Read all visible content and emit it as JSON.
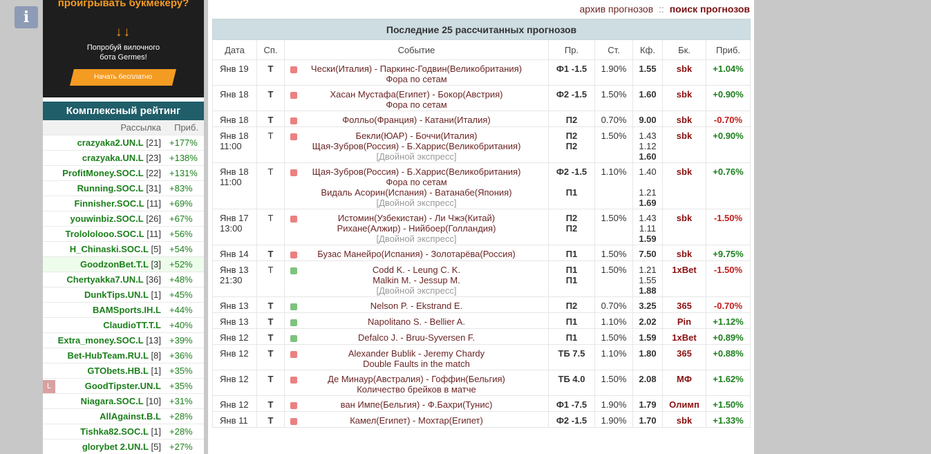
{
  "info_icon": "i",
  "ad": {
    "headline": "проигрывать букмекеру?",
    "arrows": "↓↓",
    "body_line1": "Попробуй вилочного",
    "body_line2": "бота Germes!",
    "cta": "Начать бесплатно",
    "accent_color": "#f49b22"
  },
  "rating": {
    "title": "Комплексный рейтинг",
    "col_name": "Рассылка",
    "col_profit": "Приб.",
    "items": [
      {
        "name": "crazyaka2.UN.L",
        "count": " [21]",
        "profit": "+177%"
      },
      {
        "name": "crazyaka.UN.L",
        "count": " [23]",
        "profit": "+138%"
      },
      {
        "name": "ProfitMoney.SOC.L",
        "count": " [22]",
        "profit": "+131%"
      },
      {
        "name": "Running.SOC.L",
        "count": " [31]",
        "profit": "+83%"
      },
      {
        "name": "Finnisher.SOC.L",
        "count": " [11]",
        "profit": "+69%"
      },
      {
        "name": "youwinbiz.SOC.L",
        "count": " [26]",
        "profit": "+67%"
      },
      {
        "name": "Trolololooo.SOC.L",
        "count": " [11]",
        "profit": "+56%"
      },
      {
        "name": "H_Chinaski.SOC.L",
        "count": " [5]",
        "profit": "+54%"
      },
      {
        "name": "GoodzonBet.T.L",
        "count": " [3]",
        "profit": "+52%"
      },
      {
        "name": "Chertyakka7.UN.L",
        "count": " [36]",
        "profit": "+48%"
      },
      {
        "name": "DunkTips.UN.L",
        "count": " [1]",
        "profit": "+45%"
      },
      {
        "name": "BAMSports.IH.L",
        "count": "",
        "profit": "+44%"
      },
      {
        "name": "ClaudioTT.T.L",
        "count": "",
        "profit": "+40%"
      },
      {
        "name": "Extra_money.SOC.L",
        "count": " [13]",
        "profit": "+39%"
      },
      {
        "name": "Bet-HubTeam.RU.L",
        "count": " [8]",
        "profit": "+36%"
      },
      {
        "name": "GTObets.HB.L",
        "count": " [1]",
        "profit": "+35%"
      },
      {
        "name": "GoodTipster.UN.L",
        "count": "",
        "profit": "+35%",
        "badge": "L"
      },
      {
        "name": "Niagara.SOC.L",
        "count": " [10]",
        "profit": "+31%"
      },
      {
        "name": "AllAgainst.B.L",
        "count": "",
        "profit": "+28%"
      },
      {
        "name": "Tishka82.SOC.L",
        "count": " [1]",
        "profit": "+28%"
      },
      {
        "name": "glorybet 2.UN.L",
        "count": " [5]",
        "profit": "+27%"
      }
    ]
  },
  "top_links": {
    "archive": "архив прогнозов",
    "sep": "::",
    "search": "поиск прогнозов"
  },
  "forecasts": {
    "title": "Последние 25 рассчитанных прогнозов",
    "headers": [
      "Дата",
      "Сп.",
      "Событие",
      "Пр.",
      "Ст.",
      "Кф.",
      "Бк.",
      "Приб."
    ],
    "rows": [
      {
        "date": [
          "Янв 19"
        ],
        "sport": "Т",
        "bold": true,
        "dot": "red",
        "event": [
          "Чески(Италия) - Паркинс-Годвин(Великобритания)",
          "Фора по сетам"
        ],
        "pick": [
          "Ф1 -1.5"
        ],
        "stake": "1.90%",
        "odds": [
          "1.55"
        ],
        "bk": "sbk",
        "profit": "+1.04%",
        "pos": true
      },
      {
        "date": [
          "Янв 18"
        ],
        "sport": "Т",
        "bold": true,
        "dot": "red",
        "event": [
          "Хасан Мустафа(Египет) - Бокор(Австрия)",
          "Фора по сетам"
        ],
        "pick": [
          "Ф2 -1.5"
        ],
        "stake": "1.50%",
        "odds": [
          "1.60"
        ],
        "bk": "sbk",
        "profit": "+0.90%",
        "pos": true
      },
      {
        "date": [
          "Янв 18"
        ],
        "sport": "Т",
        "bold": true,
        "dot": "red",
        "event": [
          "Фолльо(Франция) - Катани(Италия)"
        ],
        "pick": [
          "П2"
        ],
        "stake": "0.70%",
        "odds": [
          "9.00"
        ],
        "bk": "sbk",
        "profit": "-0.70%",
        "pos": false
      },
      {
        "date": [
          "Янв 18",
          "11:00"
        ],
        "sport": "Т",
        "bold": false,
        "dot": "red",
        "event": [
          "Бекли(ЮАР) - Боччи(Италия)",
          "Щая-Зубров(Россия) - Б.Харрис(Великобритания)"
        ],
        "exp": "[Двойной экспресс]",
        "pick": [
          "П2",
          "П2"
        ],
        "stake": "1.50%",
        "odds": [
          "1.43",
          "1.12",
          "1.60"
        ],
        "bk": "sbk",
        "profit": "+0.90%",
        "pos": true
      },
      {
        "date": [
          "Янв 18",
          "11:00"
        ],
        "sport": "Т",
        "bold": false,
        "dot": "red",
        "event": [
          "Щая-Зубров(Россия) - Б.Харрис(Великобритания)",
          "Фора по сетам",
          "Видаль Асорин(Испания) - Ватанабе(Япония)"
        ],
        "exp": "[Двойной экспресс]",
        "pick": [
          "Ф2 -1.5",
          "",
          "П1"
        ],
        "stake": "1.10%",
        "odds": [
          "1.40",
          "",
          "1.21",
          "1.69"
        ],
        "bk": "sbk",
        "profit": "+0.76%",
        "pos": true
      },
      {
        "date": [
          "Янв 17",
          "13:00"
        ],
        "sport": "Т",
        "bold": false,
        "dot": "red",
        "event": [
          "Истомин(Узбекистан) - Ли Чжэ(Китай)",
          "Рихане(Алжир) - Нийбоер(Голландия)"
        ],
        "exp": "[Двойной экспресс]",
        "pick": [
          "П2",
          "П2"
        ],
        "stake": "1.50%",
        "odds": [
          "1.43",
          "1.11",
          "1.59"
        ],
        "bk": "sbk",
        "profit": "-1.50%",
        "pos": false
      },
      {
        "date": [
          "Янв 14"
        ],
        "sport": "Т",
        "bold": true,
        "dot": "red",
        "event": [
          "Бузас Манейро(Испания) - Золотарёва(Россия)"
        ],
        "pick": [
          "П1"
        ],
        "stake": "1.50%",
        "odds": [
          "7.50"
        ],
        "bk": "sbk",
        "profit": "+9.75%",
        "pos": true
      },
      {
        "date": [
          "Янв 13",
          "21:30"
        ],
        "sport": "Т",
        "bold": false,
        "dot": "green",
        "event": [
          "Codd K. - Leung C. K.",
          "Malkin M. - Jessup M."
        ],
        "exp": "[Двойной экспресс]",
        "pick": [
          "П1",
          "П1"
        ],
        "stake": "1.50%",
        "odds": [
          "1.21",
          "1.55",
          "1.88"
        ],
        "bk": "1xBet",
        "profit": "-1.50%",
        "pos": false
      },
      {
        "date": [
          "Янв 13"
        ],
        "sport": "Т",
        "bold": true,
        "dot": "green",
        "event": [
          "Nelson P. - Ekstrand E."
        ],
        "pick": [
          "П2"
        ],
        "stake": "0.70%",
        "odds": [
          "3.25"
        ],
        "bk": "365",
        "profit": "-0.70%",
        "pos": false
      },
      {
        "date": [
          "Янв 13"
        ],
        "sport": "Т",
        "bold": true,
        "dot": "green",
        "event": [
          "Napolitano S. - Bellier A."
        ],
        "pick": [
          "П1"
        ],
        "stake": "1.10%",
        "odds": [
          "2.02"
        ],
        "bk": "Pin",
        "profit": "+1.12%",
        "pos": true
      },
      {
        "date": [
          "Янв 12"
        ],
        "sport": "Т",
        "bold": true,
        "dot": "green",
        "event": [
          "Defalco J. - Bruu-Syversen F."
        ],
        "pick": [
          "П1"
        ],
        "stake": "1.50%",
        "odds": [
          "1.59"
        ],
        "bk": "1xBet",
        "profit": "+0.89%",
        "pos": true
      },
      {
        "date": [
          "Янв 12"
        ],
        "sport": "Т",
        "bold": true,
        "dot": "red",
        "event": [
          "Alexander Bublik - Jeremy Chardy",
          "Double Faults in the match"
        ],
        "pick": [
          "ТБ 7.5"
        ],
        "stake": "1.10%",
        "odds": [
          "1.80"
        ],
        "bk": "365",
        "profit": "+0.88%",
        "pos": true
      },
      {
        "date": [
          "Янв 12"
        ],
        "sport": "Т",
        "bold": true,
        "dot": "red",
        "event": [
          "Де Минаур(Австралия) - Гоффин(Бельгия)",
          "Количество брейков в матче"
        ],
        "pick": [
          "ТБ 4.0"
        ],
        "stake": "1.50%",
        "odds": [
          "2.08"
        ],
        "bk": "МФ",
        "profit": "+1.62%",
        "pos": true
      },
      {
        "date": [
          "Янв 12"
        ],
        "sport": "Т",
        "bold": true,
        "dot": "red",
        "event": [
          "ван Импе(Бельгия) - Ф.Бахри(Тунис)"
        ],
        "pick": [
          "Ф1 -7.5"
        ],
        "stake": "1.90%",
        "odds": [
          "1.79"
        ],
        "bk": "Олимп",
        "profit": "+1.50%",
        "pos": true
      },
      {
        "date": [
          "Янв 11"
        ],
        "sport": "Т",
        "bold": true,
        "dot": "red",
        "event": [
          "Камел(Египет) - Мохтар(Египет)"
        ],
        "pick": [
          "Ф2 -1.5"
        ],
        "stake": "1.90%",
        "odds": [
          "1.70"
        ],
        "bk": "sbk",
        "profit": "+1.33%",
        "pos": true
      }
    ]
  }
}
